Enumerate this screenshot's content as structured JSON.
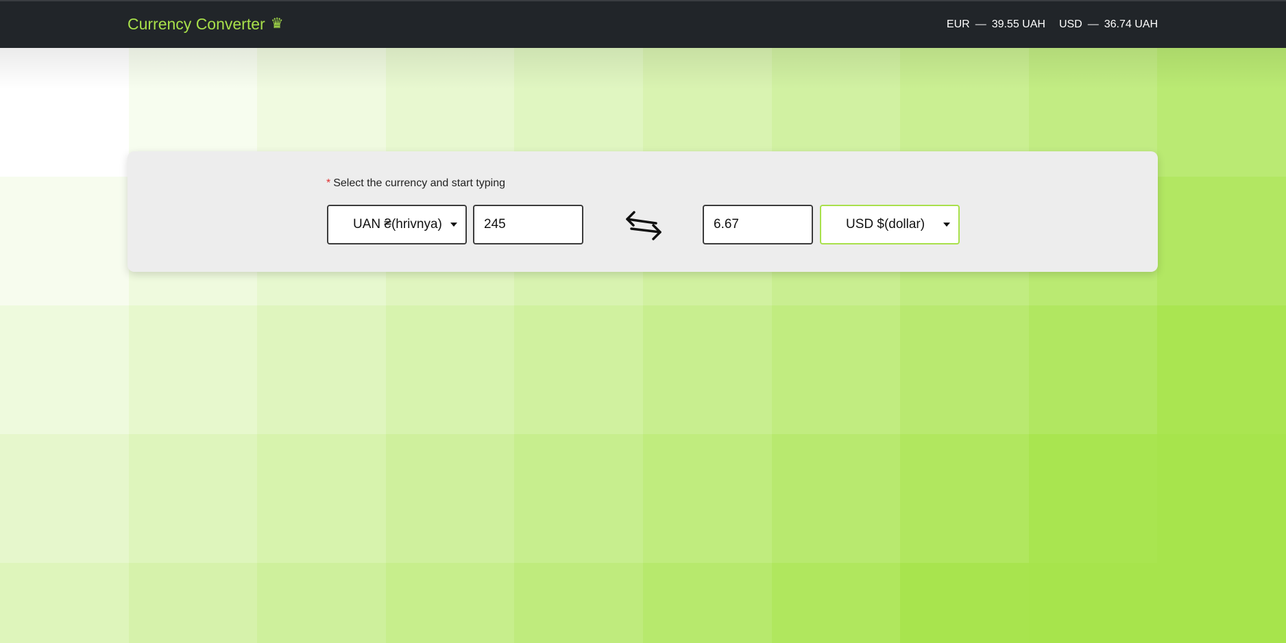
{
  "header": {
    "brand": "Currency Converter",
    "brand_icon": "crown-icon",
    "rates": [
      {
        "code": "EUR",
        "dash": "—",
        "value": "39.55 UAH"
      },
      {
        "code": "USD",
        "dash": "—",
        "value": "36.74 UAH"
      }
    ]
  },
  "converter": {
    "required_mark": "*",
    "label": "Select the currency and start typing",
    "from_currency": "UAN ₴(hrivnya)",
    "from_amount": "245",
    "swap_icon": "swap-arrows-icon",
    "to_amount": "6.67",
    "to_currency": "USD $(dollar)"
  },
  "colors": {
    "navbar": "#212529",
    "brand": "#a8e04a",
    "card": "#ededed",
    "active_border": "#a8e04a",
    "gradient_start": "#ffffff",
    "gradient_end": "#a7e44c"
  }
}
